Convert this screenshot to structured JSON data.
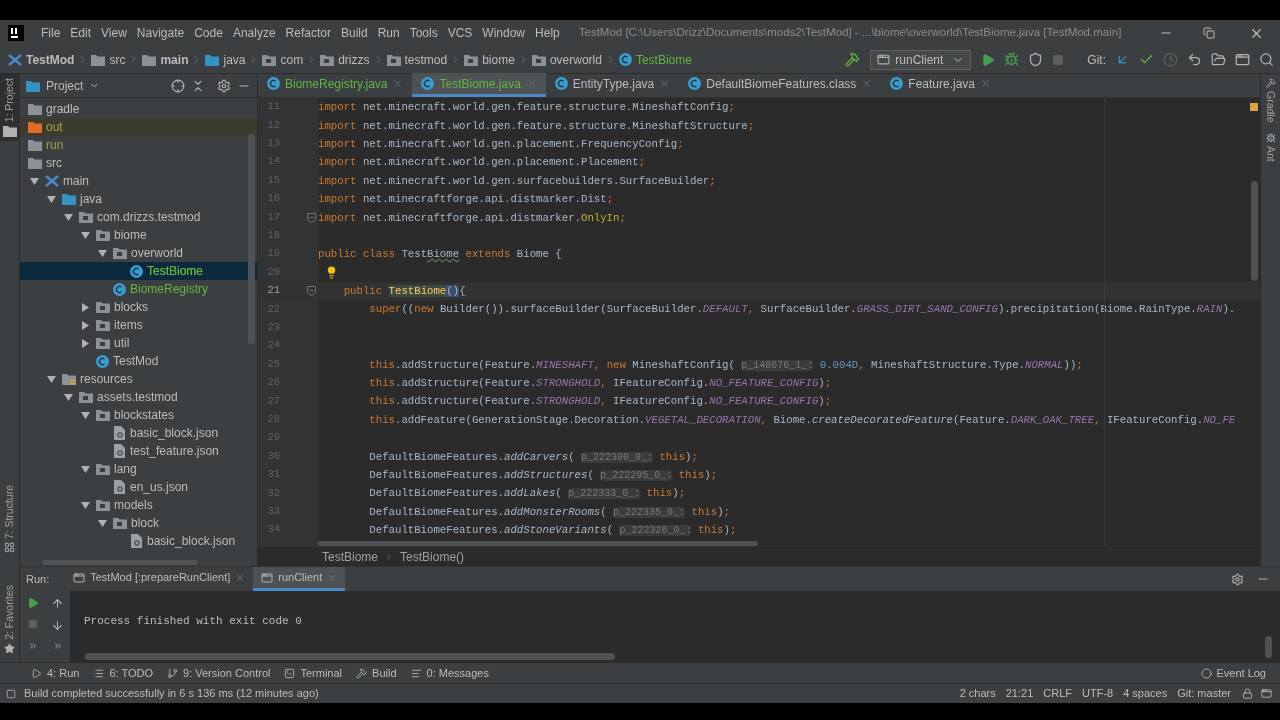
{
  "title_bar": {
    "menu": [
      "File",
      "Edit",
      "View",
      "Navigate",
      "Code",
      "Analyze",
      "Refactor",
      "Build",
      "Run",
      "Tools",
      "VCS",
      "Window",
      "Help"
    ],
    "title": "TestMod [C:\\Users\\Drizz\\Documents\\mods2\\TestMod] - ...\\biome\\overworld\\TestBiome.java [TestMod.main]"
  },
  "nav_bar": {
    "crumbs": [
      {
        "label": "TestMod",
        "kind": "module",
        "bold": true
      },
      {
        "label": "src",
        "kind": "folder",
        "bold": false
      },
      {
        "label": "main",
        "kind": "folder",
        "bold": true
      },
      {
        "label": "java",
        "kind": "folder_source",
        "bold": false
      },
      {
        "label": "com",
        "kind": "package",
        "bold": false
      },
      {
        "label": "drizzs",
        "kind": "package",
        "bold": false
      },
      {
        "label": "testmod",
        "kind": "package",
        "bold": false
      },
      {
        "label": "biome",
        "kind": "package",
        "bold": false
      },
      {
        "label": "overworld",
        "kind": "package",
        "bold": false
      },
      {
        "label": "TestBiome",
        "kind": "class",
        "color": "#62b543",
        "bold": false
      }
    ],
    "run_config": "runClient",
    "git_label": "Git:"
  },
  "left_tools": [
    {
      "label": "1: Project",
      "selected": true
    },
    {
      "label": "7: Structure",
      "selected": false
    },
    {
      "label": "2: Favorites",
      "selected": false
    }
  ],
  "project_panel": {
    "title": "Project",
    "tree": [
      {
        "label": "gradle",
        "kind": "folder",
        "selected": false
      },
      {
        "label": "out",
        "kind": "folder_excluded",
        "color": "#a1a04c",
        "highlighted": true,
        "selected": false
      },
      {
        "label": "run",
        "kind": "folder",
        "color": "#a1a04c",
        "selected": false
      },
      {
        "label": "src",
        "kind": "folder",
        "selected": false
      },
      {
        "label": "main",
        "kind": "module",
        "expanded": true,
        "selected": false,
        "children": [
          {
            "label": "java",
            "kind": "folder_source",
            "expanded": true,
            "selected": false,
            "children": [
              {
                "label": "com.drizzs.testmod",
                "kind": "package",
                "expanded": true,
                "selected": false,
                "children": [
                  {
                    "label": "biome",
                    "kind": "package",
                    "expanded": true,
                    "selected": false,
                    "children": [
                      {
                        "label": "overworld",
                        "kind": "package",
                        "expanded": true,
                        "selected": false,
                        "children": [
                          {
                            "label": "TestBiome",
                            "kind": "class",
                            "color": "#62b543",
                            "selected": true
                          }
                        ]
                      },
                      {
                        "label": "BiomeRegistry",
                        "kind": "class",
                        "color": "#62b543",
                        "selected": false
                      }
                    ]
                  },
                  {
                    "label": "blocks",
                    "kind": "package",
                    "expanded": false,
                    "selected": false
                  },
                  {
                    "label": "items",
                    "kind": "package",
                    "expanded": false,
                    "selected": false
                  },
                  {
                    "label": "util",
                    "kind": "package",
                    "expanded": false,
                    "selected": false
                  },
                  {
                    "label": "TestMod",
                    "kind": "class",
                    "selected": false
                  }
                ]
              }
            ]
          },
          {
            "label": "resources",
            "kind": "resources",
            "expanded": true,
            "selected": false,
            "children": [
              {
                "label": "assets.testmod",
                "kind": "package",
                "expanded": true,
                "selected": false,
                "children": [
                  {
                    "label": "blockstates",
                    "kind": "package",
                    "expanded": true,
                    "selected": false,
                    "children": [
                      {
                        "label": "basic_block.json",
                        "kind": "json",
                        "selected": false
                      },
                      {
                        "label": "test_feature.json",
                        "kind": "json",
                        "selected": false
                      }
                    ]
                  },
                  {
                    "label": "lang",
                    "kind": "package",
                    "expanded": true,
                    "selected": false,
                    "children": [
                      {
                        "label": "en_us.json",
                        "kind": "json",
                        "selected": false
                      }
                    ]
                  },
                  {
                    "label": "models",
                    "kind": "package",
                    "expanded": true,
                    "selected": false,
                    "children": [
                      {
                        "label": "block",
                        "kind": "package",
                        "expanded": true,
                        "selected": false,
                        "children": [
                          {
                            "label": "basic_block.json",
                            "kind": "json",
                            "selected": false
                          }
                        ]
                      }
                    ]
                  }
                ]
              }
            ]
          }
        ]
      }
    ]
  },
  "editor": {
    "tabs": [
      {
        "label": "BiomeRegistry.java",
        "color": "#62b543",
        "selected": false
      },
      {
        "label": "TestBiome.java",
        "color": "#62b543",
        "selected": true
      },
      {
        "label": "EntityType.java",
        "selected": false
      },
      {
        "label": "DefaultBiomeFeatures.class",
        "selected": false
      },
      {
        "label": "Feature.java",
        "selected": false
      }
    ],
    "lines": [
      {
        "number": "11",
        "tokens": [
          {
            "kind": "kw",
            "text": "import "
          },
          {
            "kind": "text",
            "text": "net.minecraft.world.gen.feature.structure.MineshaftConfig"
          },
          {
            "kind": "kw",
            "text": ";"
          }
        ]
      },
      {
        "number": "12",
        "tokens": [
          {
            "kind": "kw",
            "text": "import "
          },
          {
            "kind": "text",
            "text": "net.minecraft.world.gen.feature.structure.MineshaftStructure"
          },
          {
            "kind": "kw",
            "text": ";"
          }
        ]
      },
      {
        "number": "13",
        "tokens": [
          {
            "kind": "kw",
            "text": "import "
          },
          {
            "kind": "text",
            "text": "net.minecraft.world.gen.placement.FrequencyConfig"
          },
          {
            "kind": "kw",
            "text": ";"
          }
        ]
      },
      {
        "number": "14",
        "tokens": [
          {
            "kind": "kw",
            "text": "import "
          },
          {
            "kind": "text",
            "text": "net.minecraft.world.gen.placement.Placement"
          },
          {
            "kind": "kw",
            "text": ";"
          }
        ]
      },
      {
        "number": "15",
        "tokens": [
          {
            "kind": "kw",
            "text": "import "
          },
          {
            "kind": "text",
            "text": "net.minecraft.world.gen.surfacebuilders.SurfaceBuilder"
          },
          {
            "kind": "kw",
            "text": ";"
          }
        ]
      },
      {
        "number": "16",
        "tokens": [
          {
            "kind": "kw",
            "text": "import "
          },
          {
            "kind": "text",
            "text": "net.minecraftforge.api.distmarker.Dist"
          },
          {
            "kind": "kw",
            "text": ";"
          }
        ]
      },
      {
        "number": "17",
        "fold": true,
        "tokens": [
          {
            "kind": "kw",
            "text": "import "
          },
          {
            "kind": "text",
            "text": "net.minecraftforge.api.distmarker."
          },
          {
            "kind": "anno",
            "text": "OnlyIn"
          },
          {
            "kind": "kw",
            "text": ";"
          }
        ]
      },
      {
        "number": "18"
      },
      {
        "number": "19",
        "tokens": [
          {
            "kind": "kw",
            "text": "public class "
          },
          {
            "kind": "text",
            "text": "Test"
          },
          {
            "kind": "warn",
            "text": "Biome"
          },
          {
            "kind": "kw",
            "text": " extends "
          },
          {
            "kind": "text",
            "text": "Biome {"
          }
        ]
      },
      {
        "number": "20",
        "bulb": true
      },
      {
        "number": "21",
        "fold": true,
        "current": true,
        "tokens": [
          {
            "kind": "kw",
            "text": "    public "
          },
          {
            "kind": "def",
            "text": "TestBiome"
          },
          {
            "kind": "bracket",
            "text": "()"
          },
          {
            "kind": "text",
            "text": "{"
          }
        ]
      },
      {
        "number": "22",
        "tokens": [
          {
            "kind": "kw",
            "text": "        super"
          },
          {
            "kind": "text",
            "text": "(("
          },
          {
            "kind": "kw",
            "text": "new "
          },
          {
            "kind": "text",
            "text": "Builder()).surfaceBuilder(SurfaceBuilder."
          },
          {
            "kind": "field",
            "text": "DEFAULT"
          },
          {
            "kind": "kw",
            "text": ", "
          },
          {
            "kind": "text",
            "text": "SurfaceBuilder."
          },
          {
            "kind": "field",
            "text": "GRASS_DIRT_SAND_CONFIG"
          },
          {
            "kind": "text",
            "text": ").precipitation(Biome.RainType."
          },
          {
            "kind": "field",
            "text": "RAIN"
          },
          {
            "kind": "text",
            "text": ")."
          }
        ]
      },
      {
        "number": "23"
      },
      {
        "number": "24"
      },
      {
        "number": "25",
        "tokens": [
          {
            "kind": "kw",
            "text": "        this"
          },
          {
            "kind": "text",
            "text": ".addStructure(Feature."
          },
          {
            "kind": "field",
            "text": "MINESHAFT"
          },
          {
            "kind": "kw",
            "text": ", new "
          },
          {
            "kind": "text",
            "text": "MineshaftConfig( "
          },
          {
            "kind": "hint",
            "text": "p_i48676_1_:"
          },
          {
            "kind": "num",
            "text": " 0.004D"
          },
          {
            "kind": "kw",
            "text": ", "
          },
          {
            "kind": "text",
            "text": "MineshaftStructure.Type."
          },
          {
            "kind": "field",
            "text": "NORMAL"
          },
          {
            "kind": "text",
            "text": "))"
          },
          {
            "kind": "kw",
            "text": ";"
          }
        ]
      },
      {
        "number": "26",
        "tokens": [
          {
            "kind": "kw",
            "text": "        this"
          },
          {
            "kind": "text",
            "text": ".addStructure(Feature."
          },
          {
            "kind": "field",
            "text": "STRONGHOLD"
          },
          {
            "kind": "kw",
            "text": ", "
          },
          {
            "kind": "text",
            "text": "IFeatureConfig."
          },
          {
            "kind": "field",
            "text": "NO_FEATURE_CONFIG"
          },
          {
            "kind": "text",
            "text": ")"
          },
          {
            "kind": "kw",
            "text": ";"
          }
        ]
      },
      {
        "number": "27",
        "tokens": [
          {
            "kind": "kw",
            "text": "        this"
          },
          {
            "kind": "text",
            "text": ".addStructure(Feature."
          },
          {
            "kind": "field",
            "text": "STRONGHOLD"
          },
          {
            "kind": "kw",
            "text": ", "
          },
          {
            "kind": "text",
            "text": "IFeatureConfig."
          },
          {
            "kind": "field",
            "text": "NO_FEATURE_CONFIG"
          },
          {
            "kind": "text",
            "text": ")"
          },
          {
            "kind": "kw",
            "text": ";"
          }
        ]
      },
      {
        "number": "28",
        "tokens": [
          {
            "kind": "kw",
            "text": "        this"
          },
          {
            "kind": "text",
            "text": ".addFeature(GenerationStage.Decoration."
          },
          {
            "kind": "field",
            "text": "VEGETAL_DECORATION"
          },
          {
            "kind": "kw",
            "text": ", "
          },
          {
            "kind": "text",
            "text": "Biome."
          },
          {
            "kind": "call",
            "text": "createDecoratedFeature"
          },
          {
            "kind": "text",
            "text": "(Feature."
          },
          {
            "kind": "field",
            "text": "DARK_OAK_TREE"
          },
          {
            "kind": "kw",
            "text": ", "
          },
          {
            "kind": "text",
            "text": "IFeatureConfig."
          },
          {
            "kind": "field",
            "text": "NO_FE"
          }
        ]
      },
      {
        "number": "29"
      },
      {
        "number": "30",
        "tokens": [
          {
            "kind": "text",
            "text": "        DefaultBiomeFeatures."
          },
          {
            "kind": "call",
            "text": "addCarvers"
          },
          {
            "kind": "text",
            "text": "( "
          },
          {
            "kind": "hint",
            "text": "p_222300_0_:"
          },
          {
            "kind": "kw",
            "text": " this"
          },
          {
            "kind": "text",
            "text": ")"
          },
          {
            "kind": "kw",
            "text": ";"
          }
        ]
      },
      {
        "number": "31",
        "tokens": [
          {
            "kind": "text",
            "text": "        DefaultBiomeFeatures."
          },
          {
            "kind": "call",
            "text": "addStructures"
          },
          {
            "kind": "text",
            "text": "( "
          },
          {
            "kind": "hint",
            "text": "p_222295_0_:"
          },
          {
            "kind": "kw",
            "text": " this"
          },
          {
            "kind": "text",
            "text": ")"
          },
          {
            "kind": "kw",
            "text": ";"
          }
        ]
      },
      {
        "number": "32",
        "tokens": [
          {
            "kind": "text",
            "text": "        DefaultBiomeFeatures."
          },
          {
            "kind": "call",
            "text": "addLakes"
          },
          {
            "kind": "text",
            "text": "( "
          },
          {
            "kind": "hint",
            "text": "p_222333_0_:"
          },
          {
            "kind": "kw",
            "text": " this"
          },
          {
            "kind": "text",
            "text": ")"
          },
          {
            "kind": "kw",
            "text": ";"
          }
        ]
      },
      {
        "number": "33",
        "tokens": [
          {
            "kind": "text",
            "text": "        DefaultBiomeFeatures."
          },
          {
            "kind": "call",
            "text": "addMonsterRooms"
          },
          {
            "kind": "text",
            "text": "( "
          },
          {
            "kind": "hint",
            "text": "p_222335_0_:"
          },
          {
            "kind": "kw",
            "text": " this"
          },
          {
            "kind": "text",
            "text": ")"
          },
          {
            "kind": "kw",
            "text": ";"
          }
        ]
      },
      {
        "number": "34",
        "tokens": [
          {
            "kind": "text",
            "text": "        DefaultBiomeFeatures."
          },
          {
            "kind": "call",
            "text": "addStoneVariants"
          },
          {
            "kind": "text",
            "text": "( "
          },
          {
            "kind": "hint",
            "text": "p_222326_0_:"
          },
          {
            "kind": "kw",
            "text": " this"
          },
          {
            "kind": "text",
            "text": ")"
          },
          {
            "kind": "kw",
            "text": ";"
          }
        ]
      }
    ],
    "breadcrumb": [
      "TestBiome",
      "TestBiome()"
    ],
    "side_tools": [
      "Gradle",
      "Ant"
    ]
  },
  "run_panel": {
    "label": "Run:",
    "tabs": [
      {
        "label": "TestMod [:prepareRunClient]",
        "selected": false
      },
      {
        "label": "runClient",
        "selected": true
      }
    ],
    "output": "Process finished with exit code 0"
  },
  "tool_tabs": [
    {
      "label": "4: Run",
      "kind": "play"
    },
    {
      "label": "6: TODO",
      "kind": "list"
    },
    {
      "label": "9: Version Control",
      "kind": "branch"
    },
    {
      "label": "Terminal",
      "kind": "terminal"
    },
    {
      "label": "Build",
      "kind": "hammer"
    },
    {
      "label": "0: Messages",
      "kind": "messages"
    }
  ],
  "event_log": "Event Log",
  "status_bar": {
    "message": "Build completed successfully in 6 s 136 ms (12 minutes ago)",
    "items": [
      "2 chars",
      "21:21",
      "CRLF",
      "UTF-8",
      "4 spaces",
      "Git: master"
    ]
  }
}
